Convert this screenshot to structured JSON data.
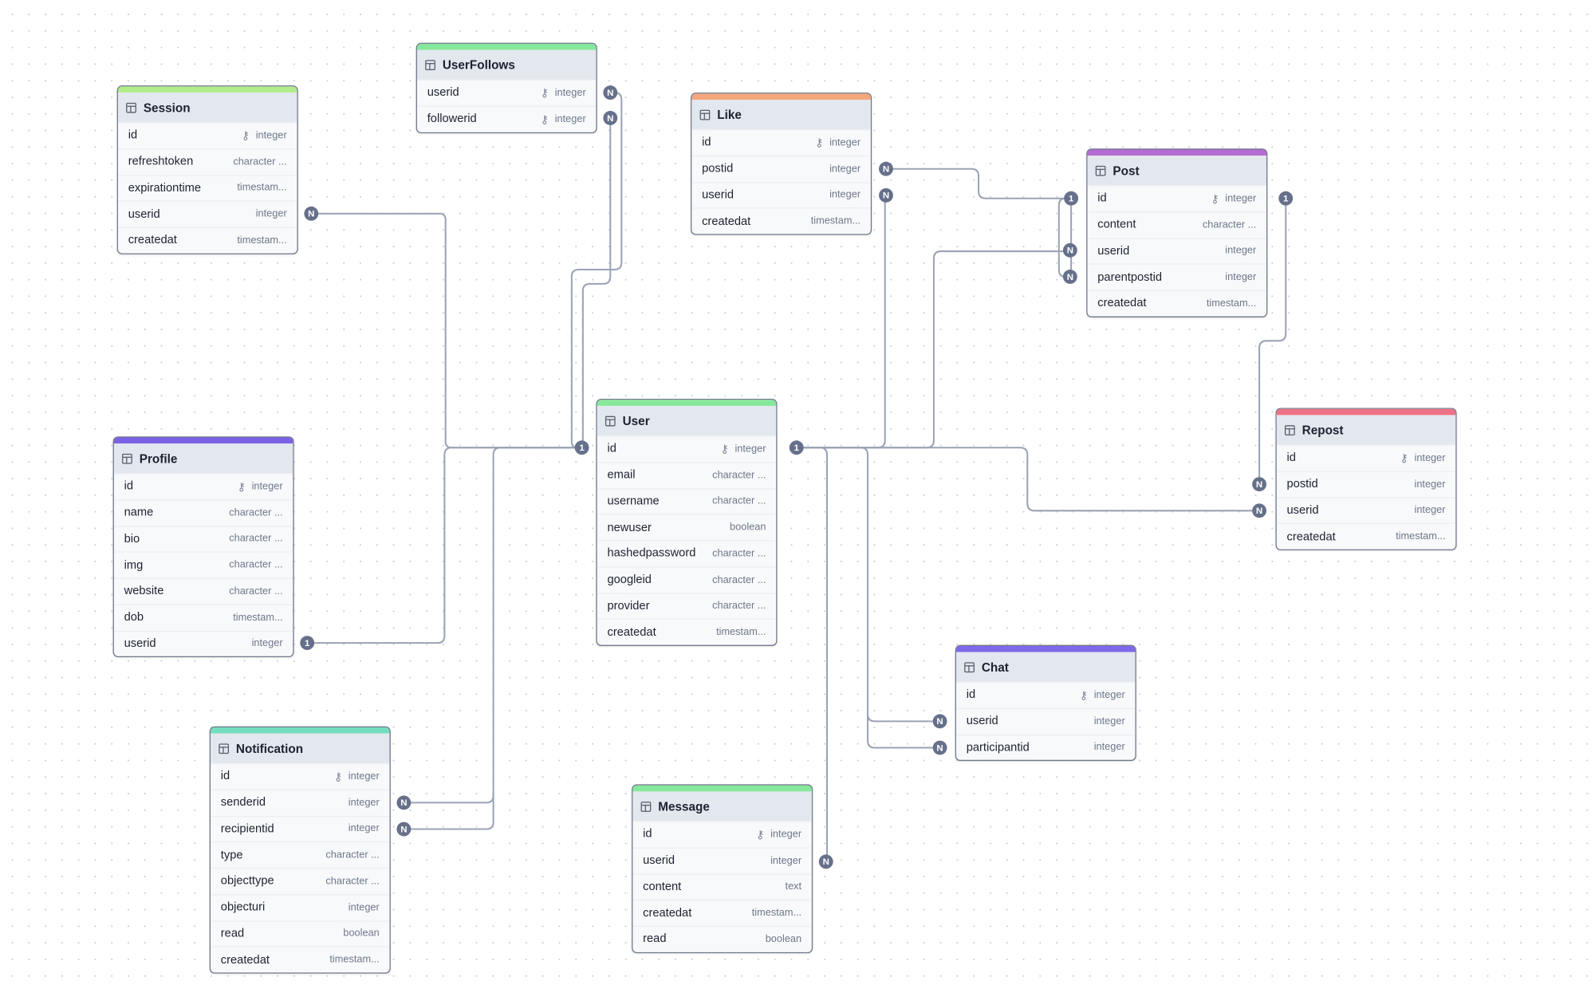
{
  "tables": [
    {
      "name": "UserFollows",
      "color": "#86e89a",
      "columns": [
        {
          "name": "userid",
          "type": "integer",
          "pk": true
        },
        {
          "name": "followerid",
          "type": "integer",
          "pk": true
        }
      ]
    },
    {
      "name": "Session",
      "color": "#b2ec8a",
      "columns": [
        {
          "name": "id",
          "type": "integer",
          "pk": true
        },
        {
          "name": "refreshtoken",
          "type": "character ...",
          "pk": false
        },
        {
          "name": "expirationtime",
          "type": "timestam...",
          "pk": false
        },
        {
          "name": "userid",
          "type": "integer",
          "pk": false
        },
        {
          "name": "createdat",
          "type": "timestam...",
          "pk": false
        }
      ]
    },
    {
      "name": "Like",
      "color": "#f4a67c",
      "columns": [
        {
          "name": "id",
          "type": "integer",
          "pk": true
        },
        {
          "name": "postid",
          "type": "integer",
          "pk": false
        },
        {
          "name": "userid",
          "type": "integer",
          "pk": false
        },
        {
          "name": "createdat",
          "type": "timestam...",
          "pk": false
        }
      ]
    },
    {
      "name": "Post",
      "color": "#b66bd0",
      "columns": [
        {
          "name": "id",
          "type": "integer",
          "pk": true
        },
        {
          "name": "content",
          "type": "character ...",
          "pk": false
        },
        {
          "name": "userid",
          "type": "integer",
          "pk": false
        },
        {
          "name": "parentpostid",
          "type": "integer",
          "pk": false
        },
        {
          "name": "createdat",
          "type": "timestam...",
          "pk": false
        }
      ]
    },
    {
      "name": "User",
      "color": "#86e89a",
      "columns": [
        {
          "name": "id",
          "type": "integer",
          "pk": true
        },
        {
          "name": "email",
          "type": "character ...",
          "pk": false
        },
        {
          "name": "username",
          "type": "character ...",
          "pk": false
        },
        {
          "name": "newuser",
          "type": "boolean",
          "pk": false
        },
        {
          "name": "hashedpassword",
          "type": "character ...",
          "pk": false
        },
        {
          "name": "googleid",
          "type": "character ...",
          "pk": false
        },
        {
          "name": "provider",
          "type": "character ...",
          "pk": false
        },
        {
          "name": "createdat",
          "type": "timestam...",
          "pk": false
        }
      ]
    },
    {
      "name": "Profile",
      "color": "#7b62e6",
      "columns": [
        {
          "name": "id",
          "type": "integer",
          "pk": true
        },
        {
          "name": "name",
          "type": "character ...",
          "pk": false
        },
        {
          "name": "bio",
          "type": "character ...",
          "pk": false
        },
        {
          "name": "img",
          "type": "character ...",
          "pk": false
        },
        {
          "name": "website",
          "type": "character ...",
          "pk": false
        },
        {
          "name": "dob",
          "type": "timestam...",
          "pk": false
        },
        {
          "name": "userid",
          "type": "integer",
          "pk": false
        }
      ]
    },
    {
      "name": "Repost",
      "color": "#ee7185",
      "columns": [
        {
          "name": "id",
          "type": "integer",
          "pk": true
        },
        {
          "name": "postid",
          "type": "integer",
          "pk": false
        },
        {
          "name": "userid",
          "type": "integer",
          "pk": false
        },
        {
          "name": "createdat",
          "type": "timestam...",
          "pk": false
        }
      ]
    },
    {
      "name": "Chat",
      "color": "#7f68ea",
      "columns": [
        {
          "name": "id",
          "type": "integer",
          "pk": true
        },
        {
          "name": "userid",
          "type": "integer",
          "pk": false
        },
        {
          "name": "participantid",
          "type": "integer",
          "pk": false
        }
      ]
    },
    {
      "name": "Notification",
      "color": "#74dcc0",
      "columns": [
        {
          "name": "id",
          "type": "integer",
          "pk": true
        },
        {
          "name": "senderid",
          "type": "integer",
          "pk": false
        },
        {
          "name": "recipientid",
          "type": "integer",
          "pk": false
        },
        {
          "name": "type",
          "type": "character ...",
          "pk": false
        },
        {
          "name": "objecttype",
          "type": "character ...",
          "pk": false
        },
        {
          "name": "objecturi",
          "type": "integer",
          "pk": false
        },
        {
          "name": "read",
          "type": "boolean",
          "pk": false
        },
        {
          "name": "createdat",
          "type": "timestam...",
          "pk": false
        }
      ]
    },
    {
      "name": "Message",
      "color": "#86e89a",
      "columns": [
        {
          "name": "id",
          "type": "integer",
          "pk": true
        },
        {
          "name": "userid",
          "type": "integer",
          "pk": false
        },
        {
          "name": "content",
          "type": "text",
          "pk": false
        },
        {
          "name": "createdat",
          "type": "timestam...",
          "pk": false
        },
        {
          "name": "read",
          "type": "boolean",
          "pk": false
        }
      ]
    }
  ],
  "relationships": [
    {
      "from": "Session.userid",
      "to": "User.id",
      "from_label": "N",
      "to_label": "1"
    },
    {
      "from": "UserFollows.userid",
      "to": "User.id",
      "from_label": "N",
      "to_label": "1"
    },
    {
      "from": "UserFollows.followerid",
      "to": "User.id",
      "from_label": "N",
      "to_label": "1"
    },
    {
      "from": "Profile.userid",
      "to": "User.id",
      "from_label": "1",
      "to_label": "1"
    },
    {
      "from": "Notification.senderid",
      "to": "User.id",
      "from_label": "N",
      "to_label": "1"
    },
    {
      "from": "Notification.recipientid",
      "to": "User.id",
      "from_label": "N",
      "to_label": "1"
    },
    {
      "from": "Like.userid",
      "to": "User.id",
      "from_label": "N",
      "to_label": "1"
    },
    {
      "from": "Post.userid",
      "to": "User.id",
      "from_label": "N",
      "to_label": "1"
    },
    {
      "from": "Repost.userid",
      "to": "User.id",
      "from_label": "N",
      "to_label": "1"
    },
    {
      "from": "Chat.userid",
      "to": "User.id",
      "from_label": "N",
      "to_label": "1"
    },
    {
      "from": "Chat.participantid",
      "to": "User.id",
      "from_label": "N",
      "to_label": "1"
    },
    {
      "from": "Message.userid",
      "to": "User.id",
      "from_label": "N",
      "to_label": "1"
    },
    {
      "from": "Like.postid",
      "to": "Post.id",
      "from_label": "N",
      "to_label": "1"
    },
    {
      "from": "Post.parentpostid",
      "to": "Post.id",
      "from_label": "N",
      "to_label": "1"
    },
    {
      "from": "Repost.postid",
      "to": "Post.id",
      "from_label": "N",
      "to_label": "1"
    }
  ],
  "icons": {
    "table": "table-icon",
    "primary_key": "key-icon"
  }
}
